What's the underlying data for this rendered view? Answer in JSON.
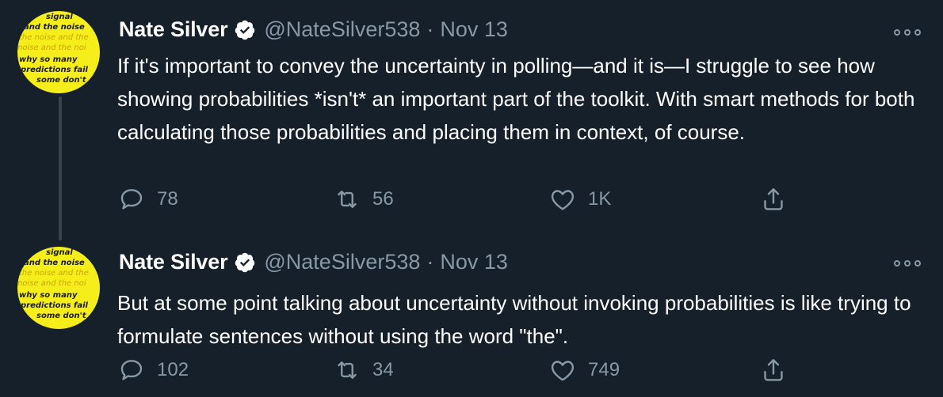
{
  "avatar_lines": [
    "signal",
    "and the noise",
    "the noise and the",
    "noise and the noi",
    "why so many",
    "predictions fail",
    "some don't"
  ],
  "tweets": [
    {
      "name": "Nate Silver",
      "handle": "@NateSilver538",
      "separator": "·",
      "date": "Nov 13",
      "text": "If it's important to convey the uncertainty in polling—and it is—I struggle to see how showing probabilities *isn't* an important part of the toolkit. With smart methods for both calculating those probabilities and placing them in context, of course.",
      "replies": "78",
      "retweets": "56",
      "likes": "1K"
    },
    {
      "name": "Nate Silver",
      "handle": "@NateSilver538",
      "separator": "·",
      "date": "Nov 13",
      "text": "But at some point talking about uncertainty without invoking probabilities is like trying to formulate sentences without using the word \"the\".",
      "replies": "102",
      "retweets": "34",
      "likes": "749"
    }
  ],
  "icons": [
    "verified-badge-icon",
    "more-options-icon",
    "reply-icon",
    "retweet-icon",
    "like-heart-icon",
    "share-icon"
  ],
  "colors": {
    "background": "#15202b",
    "text": "#ffffff",
    "muted": "#8899a6",
    "avatar": "#f5ee1b"
  }
}
